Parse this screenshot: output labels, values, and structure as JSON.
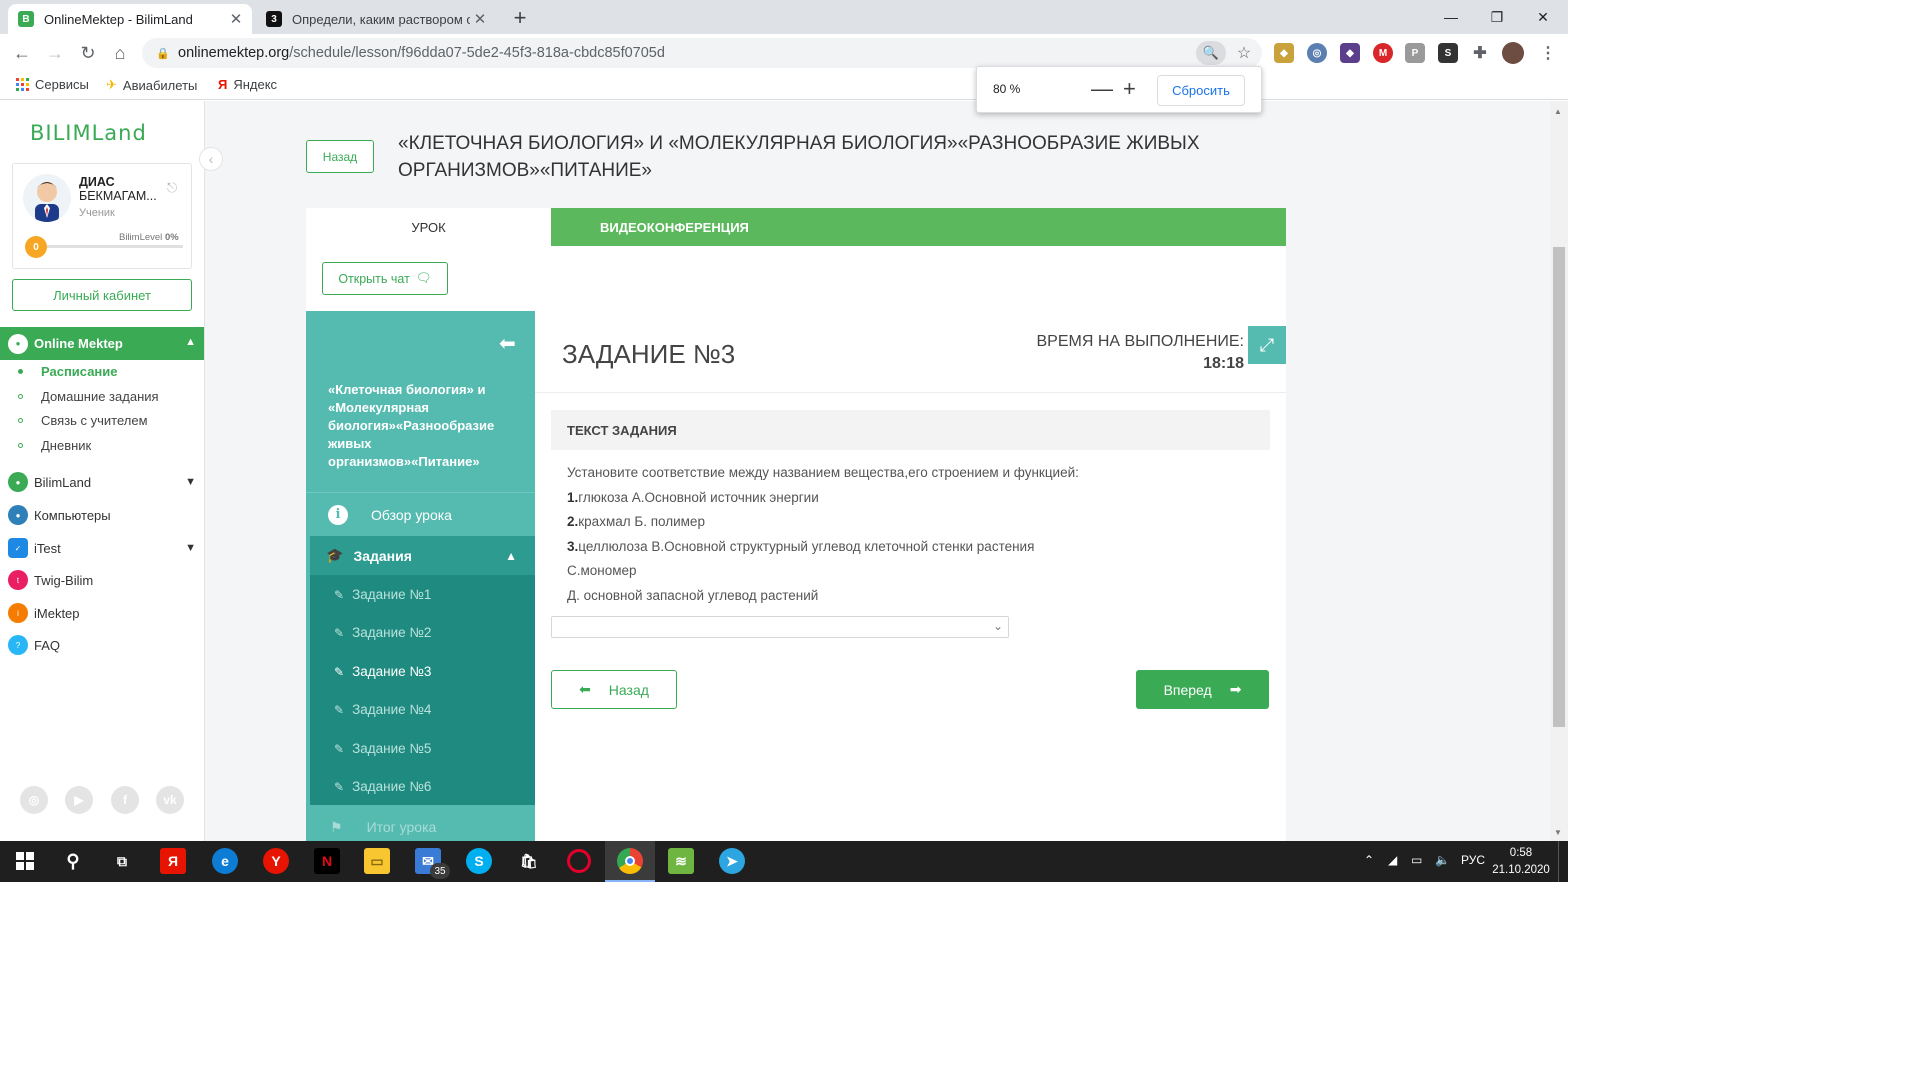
{
  "browser": {
    "tabs": [
      {
        "title": "OnlineMektep - BilimLand",
        "favicon": "B"
      },
      {
        "title": "Определи, каким раствором ог",
        "favicon": "3"
      }
    ],
    "url_host": "onlinemektep.org",
    "url_path": "/schedule/lesson/f96dda07-5de2-45f3-818a-cbdc85f0705d",
    "bookmarks": [
      "Сервисы",
      "Авиабилеты",
      "Яндекс"
    ],
    "zoom_popup": {
      "percent": "80 %",
      "minus": "—",
      "plus": "+",
      "reset": "Сбросить"
    }
  },
  "sidebar": {
    "logo": "BILIMLand",
    "profile": {
      "first_name": "ДИАС",
      "last_name": "БЕКМАГАМ...",
      "role": "Ученик",
      "level_label": "BilimLevel",
      "level_value": "0%",
      "coins": "0"
    },
    "cabinet_button": "Личный кабинет",
    "section": "Online Mektep",
    "subitems": [
      "Расписание",
      "Домашние задания",
      "Связь с учителем",
      "Дневник"
    ],
    "items": [
      "BilimLand",
      "Компьютеры",
      "iTest",
      "Twig-Bilim",
      "iMektep",
      "FAQ"
    ]
  },
  "lesson": {
    "back_button": "Назад",
    "title": "«КЛЕТОЧНАЯ БИОЛОГИЯ» И «МОЛЕКУЛЯРНАЯ БИОЛОГИЯ»«РАЗНООБРАЗИЕ ЖИВЫХ ОРГАНИЗМОВ»«ПИТАНИЕ»",
    "tab_lesson": "УРОК",
    "tab_video": "ВИДЕОКОНФЕРЕНЦИЯ",
    "open_chat": "Открыть чат",
    "nav_title": "«Клеточная биология» и «Молекулярная биология»«Разнообразие живых организмов»«Питание»",
    "overview": "Обзор урока",
    "tasks_header": "Задания",
    "tasks": [
      "Задание №1",
      "Задание №2",
      "Задание №3",
      "Задание №4",
      "Задание №5",
      "Задание №6"
    ],
    "final": "Итог урока"
  },
  "task": {
    "number": "ЗАДАНИЕ №3",
    "time_label": "ВРЕМЯ НА ВЫПОЛНЕНИЕ:",
    "time_value": "18:18",
    "text_header": "ТЕКСТ ЗАДАНИЯ",
    "intro": "Установите соответствие между названием вещества,его строением и функцией:",
    "line1_num": "1.",
    "line1": "глюкоза А.Основной источник энергии",
    "line2_num": "2.",
    "line2": "крахмал Б. полимер",
    "line3_num": "3.",
    "line3": "целлюлоза В.Основной структурный углевод клеточной стенки растения",
    "line4": "С.мономер",
    "line5": "Д. основной запасной углевод растений",
    "answer_value": "",
    "prev_button": "Назад",
    "next_button": "Вперед"
  },
  "taskbar": {
    "mail_badge": "35",
    "language": "РУС",
    "time": "0:58",
    "date": "21.10.2020"
  },
  "colors": {
    "brand_green": "#3aaa55",
    "teal": "#55bbb0",
    "teal_dark": "#1f8a7f"
  }
}
